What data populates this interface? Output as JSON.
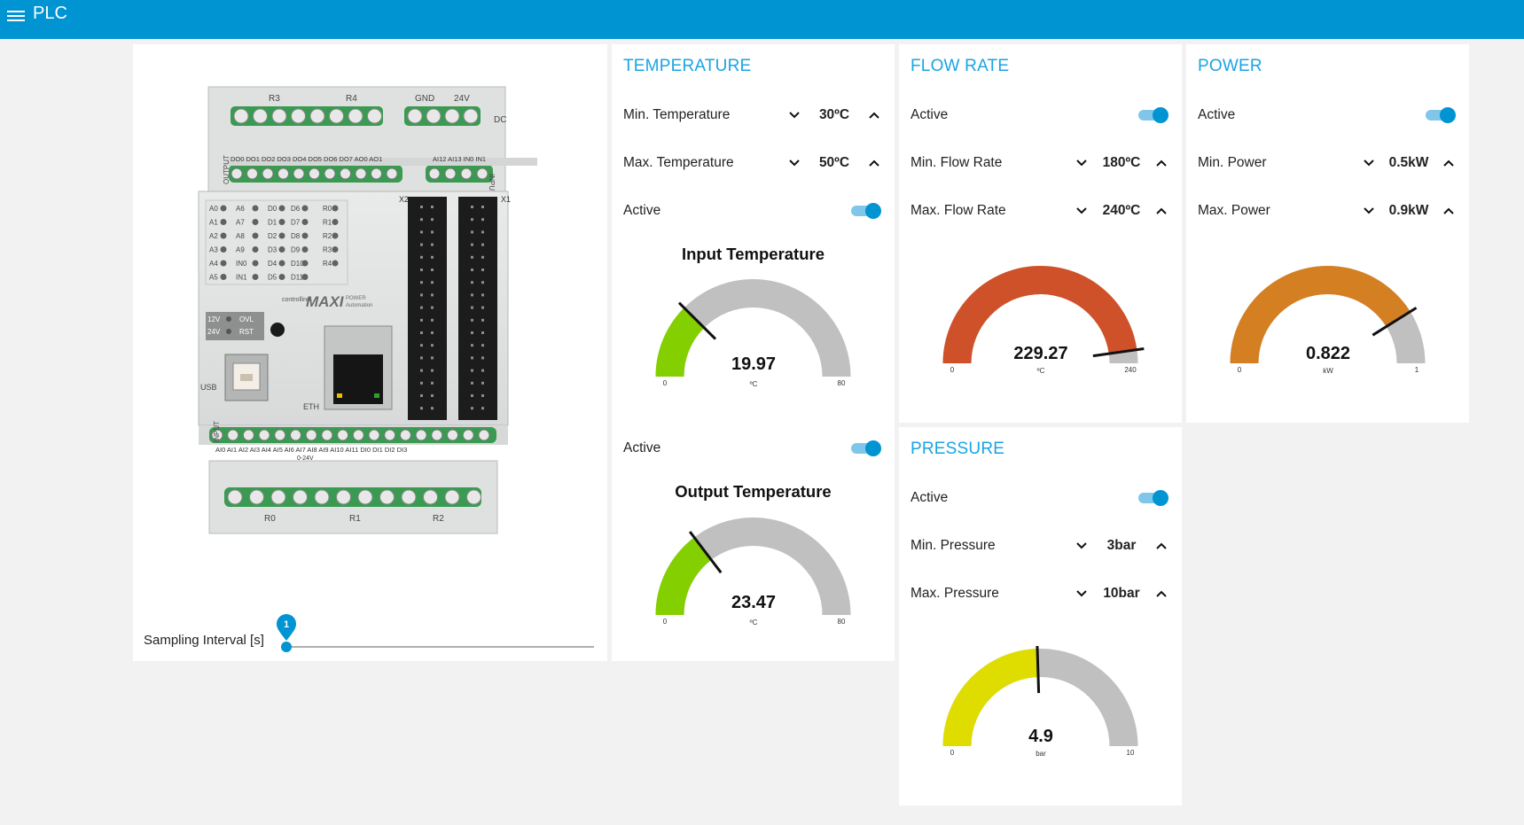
{
  "app": {
    "title": "PLC"
  },
  "device": {
    "top_labels": [
      "R3",
      "R4",
      "GND",
      "24V",
      "DC"
    ],
    "output_pins": "DO0 DO1 DO2 DO3 DO4 DO5 DO6 DO7 AO0 AO1",
    "input_pins_top": "AI12 AI13 IN0 IN1",
    "side_output": "OUTPUT",
    "side_input": "INPUT",
    "led_col1": [
      "A0",
      "A1",
      "A2",
      "A3",
      "A4",
      "A5"
    ],
    "led_col2": [
      "A6",
      "A7",
      "A8",
      "A9",
      "IN0",
      "IN1"
    ],
    "led_col3": [
      "D0",
      "D1",
      "D2",
      "D3",
      "D4",
      "D5"
    ],
    "led_col4": [
      "D6",
      "D7",
      "D8",
      "D9",
      "D10",
      "D11"
    ],
    "led_col5": [
      "R0",
      "R1",
      "R2",
      "R3",
      "R4"
    ],
    "brand": "controllino",
    "model": "MAXI",
    "model_sub1": "POWER",
    "model_sub2": "Automation",
    "pwr1": "12V",
    "pwr2": "24V",
    "stat1": "OVL",
    "stat2": "RST",
    "usb": "USB",
    "eth": "ETH",
    "x1": "X1",
    "x2": "X2",
    "bottom_pins": "AI0 AI1 AI2 AI3 AI4 AI5 AI6 AI7 AI8 AI9 AI10 AI11 DI0 DI1 DI2 DI3",
    "bottom_sub": "0-24V",
    "bottom_labels": [
      "R0",
      "R1",
      "R2"
    ]
  },
  "sampling": {
    "label": "Sampling Interval [s]",
    "value": "1"
  },
  "temperature": {
    "title": "TEMPERATURE",
    "min_label": "Min. Temperature",
    "min_value": "30ºC",
    "max_label": "Max. Temperature",
    "max_value": "50ºC",
    "active_label": "Active",
    "input_gauge": {
      "title": "Input Temperature",
      "value": "19.97",
      "unit": "ºC",
      "min": "0",
      "max": "80",
      "color": "#84cf00"
    },
    "output_active_label": "Active",
    "output_gauge": {
      "title": "Output Temperature",
      "value": "23.47",
      "unit": "ºC",
      "min": "0",
      "max": "80",
      "color": "#84cf00"
    }
  },
  "flow": {
    "title": "FLOW RATE",
    "active_label": "Active",
    "min_label": "Min. Flow Rate",
    "min_value": "180ºC",
    "max_label": "Max. Flow Rate",
    "max_value": "240ºC",
    "gauge": {
      "value": "229.27",
      "unit": "ºC",
      "min": "0",
      "max": "240",
      "color": "#cf512a"
    }
  },
  "power": {
    "title": "POWER",
    "active_label": "Active",
    "min_label": "Min. Power",
    "min_value": "0.5kW",
    "max_label": "Max. Power",
    "max_value": "0.9kW",
    "gauge": {
      "value": "0.822",
      "unit": "kW",
      "min": "0",
      "max": "1",
      "color": "#d47f22"
    }
  },
  "pressure": {
    "title": "PRESSURE",
    "active_label": "Active",
    "min_label": "Min. Pressure",
    "min_value": "3bar",
    "max_label": "Max. Pressure",
    "max_value": "10bar",
    "gauge": {
      "value": "4.9",
      "unit": "bar",
      "min": "0",
      "max": "10",
      "color": "#dfdd00"
    }
  },
  "colors": {
    "accent": "#0094d3",
    "title": "#1aa4e3",
    "gauge_bg": "#c0c0c0"
  }
}
